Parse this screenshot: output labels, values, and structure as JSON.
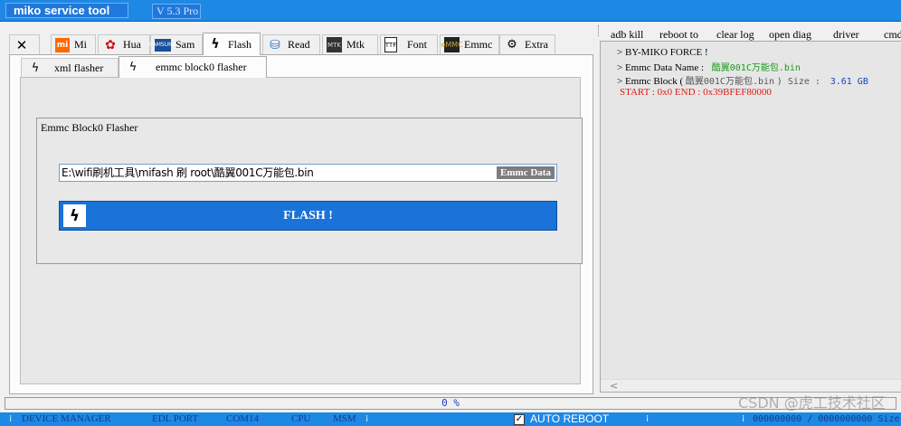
{
  "app": {
    "title": "miko service tool",
    "version": "V 5.3 Pro"
  },
  "main_tabs": [
    {
      "label": "",
      "icon": "wrench-screwdriver-icon",
      "glyph": "✕"
    },
    {
      "label": "Mi",
      "icon": "xiaomi-logo-icon",
      "glyph": "mi"
    },
    {
      "label": "Hua",
      "icon": "huawei-logo-icon",
      "glyph": "✿"
    },
    {
      "label": "Sam",
      "icon": "samsung-logo-icon",
      "glyph": "SAMSUNG"
    },
    {
      "label": "Flash",
      "icon": "lightning-icon",
      "glyph": "ϟ"
    },
    {
      "label": "Read",
      "icon": "database-icon",
      "glyph": "⛁"
    },
    {
      "label": "Mtk",
      "icon": "chip-icon",
      "glyph": "MTK"
    },
    {
      "label": "Font",
      "icon": "ttf-file-icon",
      "glyph": "TTF"
    },
    {
      "label": "Emmc",
      "icon": "emmc-chip-icon",
      "glyph": "eMMC"
    },
    {
      "label": "Extra",
      "icon": "gears-icon",
      "glyph": "⚙"
    }
  ],
  "sub_tabs": [
    {
      "label": "xml flasher",
      "icon": "lightning-icon",
      "glyph": "ϟ"
    },
    {
      "label": "emmc block0 flasher",
      "icon": "lightning-icon",
      "glyph": "ϟ"
    }
  ],
  "flasher": {
    "title": "Emmc Block0 Flasher",
    "file_path": "E:\\wifi刷机工具\\mifash 刷 root\\酷翼001C万能包.bin",
    "emmc_data_label": "Emmc Data",
    "flash_label": "FLASH !",
    "flash_icon_glyph": "ϟ"
  },
  "right_toolbar": [
    "adb kill",
    "reboot to",
    "clear log",
    "open diag",
    "driver",
    "cmd"
  ],
  "log": {
    "line1": "> BY-MIKO FORCE !",
    "line2_prefix": "> Emmc Data Name :",
    "line2_value": "酷翼001C万能包.bin",
    "line3_prefix": "> Emmc Block (",
    "line3_name": "酷翼001C万能包.bin",
    "line3_mid": ") Size   :",
    "line3_size": "3.61 GB",
    "line4": "START :  0x0    END :  0x39BFEF80000",
    "scroll_glyph": "<"
  },
  "progress": {
    "percent": 0,
    "text": "0 %"
  },
  "status_bar": {
    "device_manager": "DEVICE MANAGER",
    "edl_port": "EDL PORT",
    "com": "COM14",
    "cpu": "CPU",
    "msm": "MSM",
    "auto_reboot": "AUTO REBOOT",
    "auto_reboot_checked": true,
    "check_glyph": "✓",
    "sizes": "000000000 / 0000000000 Size",
    "grip_glyph": "⁞"
  },
  "watermark": "CSDN @虎工技术社区",
  "colors": {
    "title_bar": "#1e88e5",
    "flash_button": "#1a73d8",
    "log_green": "#1a9a1a",
    "log_red": "#e01818",
    "log_blue": "#1a3fc8"
  }
}
